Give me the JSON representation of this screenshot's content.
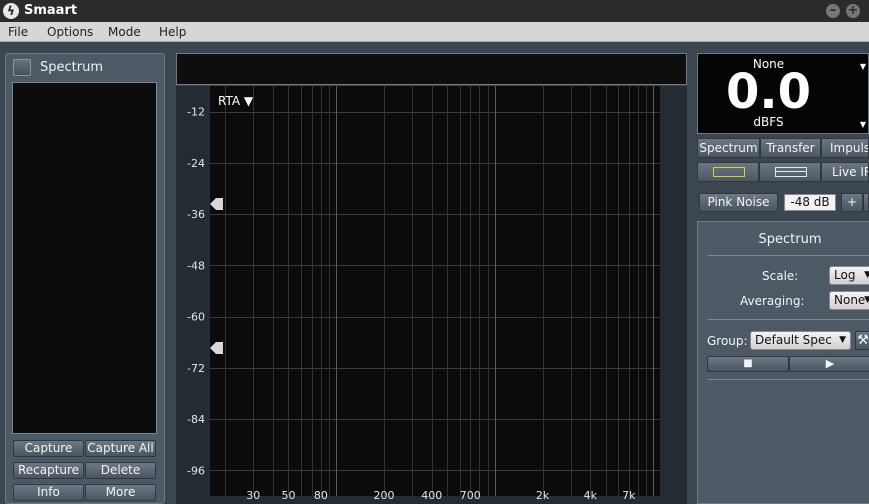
{
  "window": {
    "title": "Smaart"
  },
  "menu": [
    "File",
    "Options",
    "Mode",
    "Help"
  ],
  "left_panel": {
    "title": "Spectrum",
    "buttons": [
      "Capture",
      "Capture All",
      "Recapture",
      "Delete",
      "Info",
      "More"
    ]
  },
  "graph": {
    "mode_label": "RTA ▼",
    "y_ticks": [
      "-12",
      "-24",
      "-36",
      "-48",
      "-60",
      "-72",
      "-84",
      "-96"
    ],
    "x_ticks": [
      "30",
      "50",
      "80",
      "200",
      "400",
      "700",
      "2k",
      "4k",
      "7k"
    ]
  },
  "meter": {
    "source": "None",
    "value": "0.0",
    "unit": "dBFS"
  },
  "measurement_tabs": [
    "Spectrum",
    "Transfer",
    "Impulse"
  ],
  "mode_buttons": {
    "live_ir": "Live IR"
  },
  "generator": {
    "label": "Pink Noise",
    "level": "-48 dB",
    "plus": "+"
  },
  "settings": {
    "title": "Spectrum",
    "scale_label": "Scale:",
    "scale_value": "Log",
    "averaging_label": "Averaging:",
    "averaging_value": "None",
    "group_label": "Group:",
    "group_value": "Default Spec"
  },
  "colors": {
    "accent_yellow": "#d8d040",
    "plot_bg": "#0b0b0b",
    "panel": "#4d5965"
  }
}
